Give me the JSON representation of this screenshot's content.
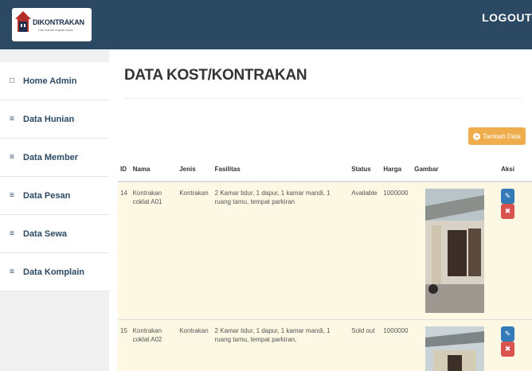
{
  "brand": {
    "logo_text": "DIKONTRAKAN",
    "logo_sub": "Cari Kamar Impian Anda"
  },
  "header": {
    "logout_label": "LOGOUT"
  },
  "sidebar": {
    "items": [
      {
        "label": "Home Admin",
        "icon": "monitor-icon"
      },
      {
        "label": "Data Hunian",
        "icon": "list-icon"
      },
      {
        "label": "Data Member",
        "icon": "list-icon"
      },
      {
        "label": "Data Pesan",
        "icon": "list-icon"
      },
      {
        "label": "Data Sewa",
        "icon": "list-icon"
      },
      {
        "label": "Data Komplain",
        "icon": "list-icon"
      }
    ]
  },
  "main": {
    "title": "DATA KOST/KONTRAKAN",
    "add_button_label": "Tambah Data"
  },
  "table": {
    "headers": [
      "ID",
      "Nama",
      "Jenis",
      "Fasilitas",
      "Status",
      "Harga",
      "Gambar",
      "Aksi"
    ],
    "rows": [
      {
        "id": "14",
        "nama": "Kontrakan coklat A01",
        "jenis": "Kontrakan",
        "fasilitas": "2 Kamar tidur, 1 dapur, 1 kamar mandi, 1 ruang tamu, tempat parkiran",
        "status": "Available",
        "harga": "1000000"
      },
      {
        "id": "15",
        "nama": "Kontrakan coklat A02",
        "jenis": "Kontrakan",
        "fasilitas": "2 Kamar tidur, 1 dapur, 1 kamar mandi, 1 ruang tamu, tempat parkiran,",
        "status": "Sold out",
        "harga": "1000000"
      }
    ]
  },
  "colors": {
    "header_bg": "#2c4964",
    "row_highlight": "#fcf8e3",
    "add_button": "#f0ad4e",
    "edit_button": "#337ab7",
    "delete_button": "#d9534f"
  }
}
